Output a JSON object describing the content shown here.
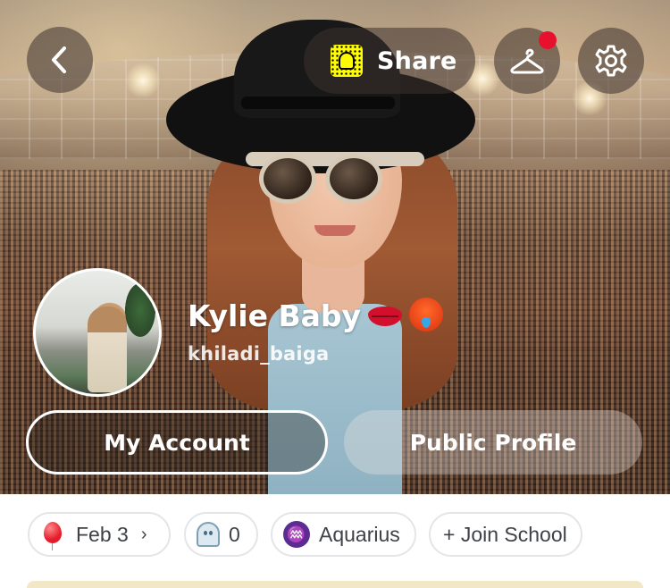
{
  "header": {
    "share_label": "Share"
  },
  "profile": {
    "display_name": "Kylie Baby",
    "username": "khiladi_baiga",
    "name_emojis": [
      "lips-icon",
      "hot-face-icon"
    ]
  },
  "actions": {
    "my_account_label": "My Account",
    "public_profile_label": "Public Profile"
  },
  "chips": {
    "birthday": "Feb 3",
    "friends_count": "0",
    "zodiac": "Aquarius",
    "school": "+ Join School"
  },
  "icons": {
    "back": "chevron-left-icon",
    "wardrobe": "hanger-icon",
    "settings": "gear-icon",
    "snapcode": "snapcode-icon",
    "birthday": "balloon-icon",
    "friends": "ghost-icon",
    "zodiac": "aquarius-icon"
  },
  "colors": {
    "notification_dot": "#e8112d",
    "snapcode_yellow": "#fffc00",
    "zodiac_purple": "#5a2d91"
  }
}
